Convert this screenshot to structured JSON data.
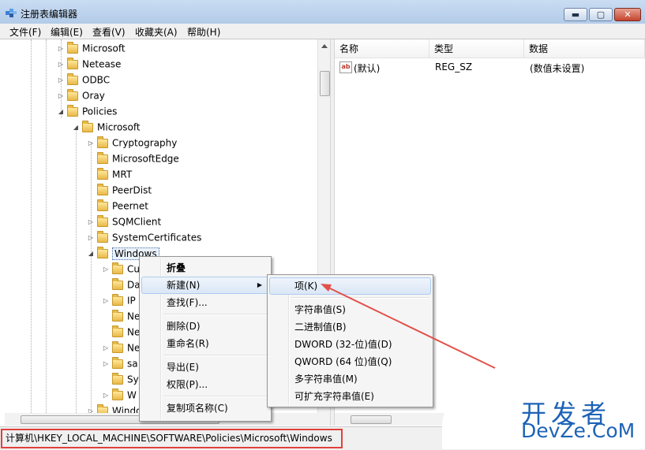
{
  "window": {
    "title": "注册表编辑器",
    "min": "▬",
    "max": "▢",
    "close": "✕"
  },
  "menubar": [
    "文件(F)",
    "编辑(E)",
    "查看(V)",
    "收藏夹(A)",
    "帮助(H)"
  ],
  "tree": [
    {
      "label": "Microsoft",
      "exp": "▷"
    },
    {
      "label": "Netease",
      "exp": "▷"
    },
    {
      "label": "ODBC",
      "exp": "▷"
    },
    {
      "label": "Oray",
      "exp": "▷"
    },
    {
      "label": "Policies",
      "exp": "◢"
    },
    {
      "label": "Microsoft",
      "exp": "◢"
    },
    {
      "label": "Cryptography",
      "exp": "▷"
    },
    {
      "label": "MicrosoftEdge",
      "exp": ""
    },
    {
      "label": "MRT",
      "exp": ""
    },
    {
      "label": "PeerDist",
      "exp": ""
    },
    {
      "label": "Peernet",
      "exp": ""
    },
    {
      "label": "SQMClient",
      "exp": "▷"
    },
    {
      "label": "SystemCertificates",
      "exp": "▷"
    },
    {
      "label": "Windows",
      "exp": "◢"
    },
    {
      "label": "Cu",
      "exp": "▷"
    },
    {
      "label": "Da",
      "exp": ""
    },
    {
      "label": "IP",
      "exp": "▷"
    },
    {
      "label": "Ne",
      "exp": ""
    },
    {
      "label": "Ne",
      "exp": ""
    },
    {
      "label": "Ne",
      "exp": "▷"
    },
    {
      "label": "sa",
      "exp": "▷"
    },
    {
      "label": "Sy",
      "exp": ""
    },
    {
      "label": "W",
      "exp": "▷"
    },
    {
      "label": "Windo",
      "exp": "▷"
    }
  ],
  "list": {
    "headers": {
      "name": "名称",
      "type": "类型",
      "data": "数据"
    },
    "rows": [
      {
        "icon": "ab",
        "name": "(默认)",
        "type": "REG_SZ",
        "data": "(数值未设置)"
      }
    ]
  },
  "context_menu": [
    "折叠",
    "新建(N)",
    "查找(F)...",
    "删除(D)",
    "重命名(R)",
    "导出(E)",
    "权限(P)...",
    "复制项名称(C)"
  ],
  "submenu": [
    "项(K)",
    "字符串值(S)",
    "二进制值(B)",
    "DWORD (32-位)值(D)",
    "QWORD (64 位)值(Q)",
    "多字符串值(M)",
    "可扩充字符串值(E)"
  ],
  "statusbar": {
    "path": "计算机\\HKEY_LOCAL_MACHINE\\SOFTWARE\\Policies\\Microsoft\\Windows"
  },
  "watermark": {
    "line1": "开发者",
    "line2": "DevZe.CoM"
  },
  "colors": {
    "titlebar": "#b9cfea",
    "highlight_border": "#e0413a",
    "watermark": "#1e63b6"
  }
}
